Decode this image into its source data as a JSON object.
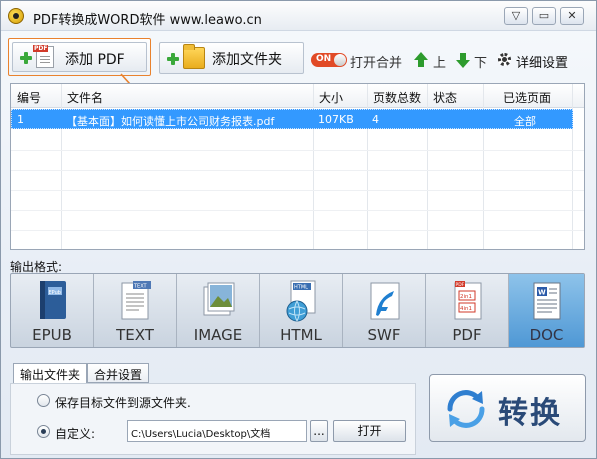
{
  "window": {
    "title": "PDF转换成WORD软件 www.leawo.cn",
    "controls": {
      "minimize": "▽",
      "restore": "▭",
      "close": "✕"
    }
  },
  "toolbar": {
    "add_pdf": "添加 PDF",
    "add_folder": "添加文件夹",
    "toggle_state": "ON",
    "open_merge": "打开合并",
    "move_up": "上",
    "move_down": "下",
    "settings": "详细设置"
  },
  "file_table": {
    "columns": [
      "编号",
      "文件名",
      "大小",
      "页数总数",
      "状态",
      "已选页面"
    ],
    "rows": [
      {
        "index": "1",
        "name": "【基本面】如何读懂上市公司财务报表.pdf",
        "size": "107KB",
        "pages": "4",
        "status": "",
        "selected_pages": "全部"
      }
    ]
  },
  "output": {
    "label": "输出格式:",
    "formats": [
      "EPUB",
      "TEXT",
      "IMAGE",
      "HTML",
      "SWF",
      "PDF",
      "DOC"
    ],
    "selected": "DOC"
  },
  "settings": {
    "tabs": [
      "输出文件夹",
      "合并设置"
    ],
    "active_tab": "输出文件夹",
    "option_source": "保存目标文件到源文件夹.",
    "option_custom": "自定义:",
    "custom_selected": true,
    "path_value": "C:\\Users\\Lucia\\Desktop\\文档",
    "browse_label": "...",
    "open_label": "打开"
  },
  "convert": {
    "label": "转换"
  },
  "colors": {
    "selection": "#3399ff",
    "accent": "#e9822e",
    "toggle_on": "#e14a26",
    "selected_format": "#4f98d5"
  }
}
